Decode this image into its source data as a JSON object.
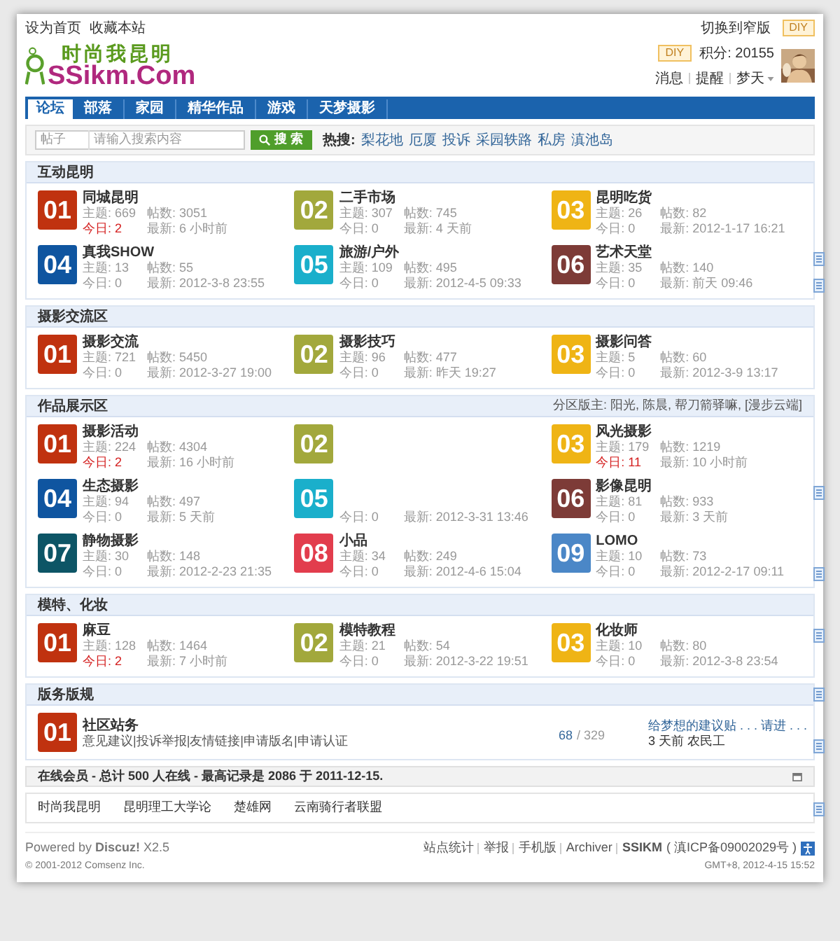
{
  "topbar": {
    "links": [
      "设为首页",
      "收藏本站"
    ],
    "switch_link": "切换到窄版",
    "diy": "DIY"
  },
  "header": {
    "logo_title": "时尚我昆明",
    "logo_domain": "SSikm.Com",
    "diy": "DIY",
    "points": "积分: 20155",
    "user_links": [
      "消息",
      "提醒"
    ],
    "username": "梦天"
  },
  "nav": [
    {
      "label": "论坛",
      "selected": true
    },
    {
      "label": "部落",
      "selected": false
    },
    {
      "label": "家园",
      "selected": false
    },
    {
      "label": "精华作品",
      "selected": false
    },
    {
      "label": "游戏",
      "selected": false
    },
    {
      "label": "天梦摄影",
      "selected": false
    }
  ],
  "search": {
    "scope": "帖子",
    "placeholder": "请输入搜索内容",
    "button": "搜 索",
    "hot_label": "热搜:",
    "hot": [
      "梨花地",
      "厄厦",
      "投诉",
      "采园轶路",
      "私房",
      "滇池岛"
    ]
  },
  "sections": [
    {
      "title": "互动昆明",
      "kind": "grid",
      "forums": [
        {
          "number": "01",
          "color": "#c0320f",
          "name": "同城昆明",
          "stats": {
            "threads": "主题: 669",
            "posts": "帖数: 3051",
            "today": "今日: 2",
            "latest": "最新: 6 小时前"
          },
          "today_highlight": true
        },
        {
          "number": "02",
          "color": "#a2a83c",
          "name": "二手市场",
          "stats": {
            "threads": "主题: 307",
            "posts": "帖数: 745",
            "today": "今日: 0",
            "latest": "最新: 4 天前"
          },
          "today_highlight": false
        },
        {
          "number": "03",
          "color": "#efb415",
          "name": "昆明吃货",
          "stats": {
            "threads": "主题: 26",
            "posts": "帖数: 82",
            "today": "今日: 0",
            "latest": "最新: 2012-1-17 16:21"
          },
          "today_highlight": false
        },
        {
          "number": "04",
          "color": "#0f55a0",
          "name": "真我SHOW",
          "stats": {
            "threads": "主题: 13",
            "posts": "帖数: 55",
            "today": "今日: 0",
            "latest": "最新: 2012-3-8 23:55"
          },
          "today_highlight": false
        },
        {
          "number": "05",
          "color": "#1aafcb",
          "name": "旅游/户外",
          "stats": {
            "threads": "主题: 109",
            "posts": "帖数: 495",
            "today": "今日: 0",
            "latest": "最新: 2012-4-5 09:33"
          },
          "today_highlight": false
        },
        {
          "number": "06",
          "color": "#7d3b37",
          "name": "艺术天堂",
          "stats": {
            "threads": "主题: 35",
            "posts": "帖数: 140",
            "today": "今日: 0",
            "latest": "最新: 前天 09:46"
          },
          "today_highlight": false
        }
      ]
    },
    {
      "title": "摄影交流区",
      "kind": "grid",
      "forums": [
        {
          "number": "01",
          "color": "#c0320f",
          "name": "摄影交流",
          "stats": {
            "threads": "主题: 721",
            "posts": "帖数: 5450",
            "today": "今日: 0",
            "latest": "最新: 2012-3-27 19:00"
          },
          "today_highlight": false
        },
        {
          "number": "02",
          "color": "#a2a83c",
          "name": "摄影技巧",
          "stats": {
            "threads": "主题: 96",
            "posts": "帖数: 477",
            "today": "今日: 0",
            "latest": "最新: 昨天 19:27"
          },
          "today_highlight": false
        },
        {
          "number": "03",
          "color": "#efb415",
          "name": "摄影问答",
          "stats": {
            "threads": "主题: 5",
            "posts": "帖数: 60",
            "today": "今日: 0",
            "latest": "最新: 2012-3-9 13:17"
          },
          "today_highlight": false
        }
      ]
    },
    {
      "title": "作品展示区",
      "kind": "grid",
      "moderators": "分区版主: 阳光, 陈晨, 帮刀箭驿嘛, [漫步云端]",
      "forums": [
        {
          "number": "01",
          "color": "#c0320f",
          "name": "摄影活动",
          "stats": {
            "threads": "主题: 224",
            "posts": "帖数: 4304",
            "today": "今日: 2",
            "latest": "最新: 16 小时前"
          },
          "today_highlight": true
        },
        {
          "number": "02",
          "color": "#a2a83c"
        },
        {
          "number": "03",
          "color": "#efb415",
          "name": "风光摄影",
          "stats": {
            "threads": "主题: 179",
            "posts": "帖数: 1219",
            "today": "今日: 11",
            "latest": "最新: 10 小时前"
          },
          "today_highlight": true
        },
        {
          "number": "04",
          "color": "#0f55a0",
          "name": "生态摄影",
          "stats": {
            "threads": "主题: 94",
            "posts": "帖数: 497",
            "today": "今日: 0",
            "latest": "最新: 5 天前"
          },
          "today_highlight": false
        },
        {
          "number": "05",
          "color": "#1aafcb",
          "stats": {
            "today": "今日: 0",
            "latest": "最新: 2012-3-31 13:46"
          },
          "today_highlight": false
        },
        {
          "number": "06",
          "color": "#7d3b37",
          "name": "影像昆明",
          "stats": {
            "threads": "主题: 81",
            "posts": "帖数: 933",
            "today": "今日: 0",
            "latest": "最新: 3 天前"
          },
          "today_highlight": false
        },
        {
          "number": "07",
          "color": "#0d5566",
          "name": "静物摄影",
          "stats": {
            "threads": "主题: 30",
            "posts": "帖数: 148",
            "today": "今日: 0",
            "latest": "最新: 2012-2-23 21:35"
          },
          "today_highlight": false
        },
        {
          "number": "08",
          "color": "#e23d4d",
          "name": "小品",
          "stats": {
            "threads": "主题: 34",
            "posts": "帖数: 249",
            "today": "今日: 0",
            "latest": "最新: 2012-4-6 15:04"
          },
          "today_highlight": false
        },
        {
          "number": "09",
          "color": "#4b87c7",
          "name": "LOMO",
          "stats": {
            "threads": "主题: 10",
            "posts": "帖数: 73",
            "today": "今日: 0",
            "latest": "最新: 2012-2-17 09:11"
          },
          "today_highlight": false
        }
      ]
    },
    {
      "title": "模特、化妆",
      "kind": "grid",
      "forums": [
        {
          "number": "01",
          "color": "#c0320f",
          "name": "麻豆",
          "stats": {
            "threads": "主题: 128",
            "posts": "帖数: 1464",
            "today": "今日: 2",
            "latest": "最新: 7 小时前"
          },
          "today_highlight": true
        },
        {
          "number": "02",
          "color": "#a2a83c",
          "name": "模特教程",
          "stats": {
            "threads": "主题: 21",
            "posts": "帖数: 54",
            "today": "今日: 0",
            "latest": "最新: 2012-3-22 19:51"
          },
          "today_highlight": false
        },
        {
          "number": "03",
          "color": "#efb415",
          "name": "化妆师",
          "stats": {
            "threads": "主题: 10",
            "posts": "帖数: 80",
            "today": "今日: 0",
            "latest": "最新: 2012-3-8 23:54"
          },
          "today_highlight": false
        }
      ]
    },
    {
      "title": "版务版规",
      "kind": "list",
      "forums": [
        {
          "number": "01",
          "color": "#c0320f",
          "name": "社区站务",
          "description": "意见建议|投诉举报|友情链接|申请版名|申请认证",
          "count_threads": "68",
          "count_posts": "/ 329",
          "last_post": "给梦想的建议贴 . . . 请进 . . .",
          "last_meta": "3 天前 农民工"
        }
      ]
    }
  ],
  "online": "在线会员 - 总计 500 人在线 - 最高记录是 2086 于 2011-12-15.",
  "friend_links": [
    "时尚我昆明",
    "昆明理工大学论",
    "楚雄网",
    "云南骑行者联盟"
  ],
  "footer": {
    "powered": "Powered by **Discuz!** X2.5",
    "copyright": "© 2001-2012 Comsenz Inc.",
    "links": [
      "站点统计",
      "举报",
      "手机版",
      "Archiver"
    ],
    "site": "SSIKM",
    "icp": "( 滇ICP备09002029号 )",
    "time": "GMT+8, 2012-4-15 15:52"
  }
}
